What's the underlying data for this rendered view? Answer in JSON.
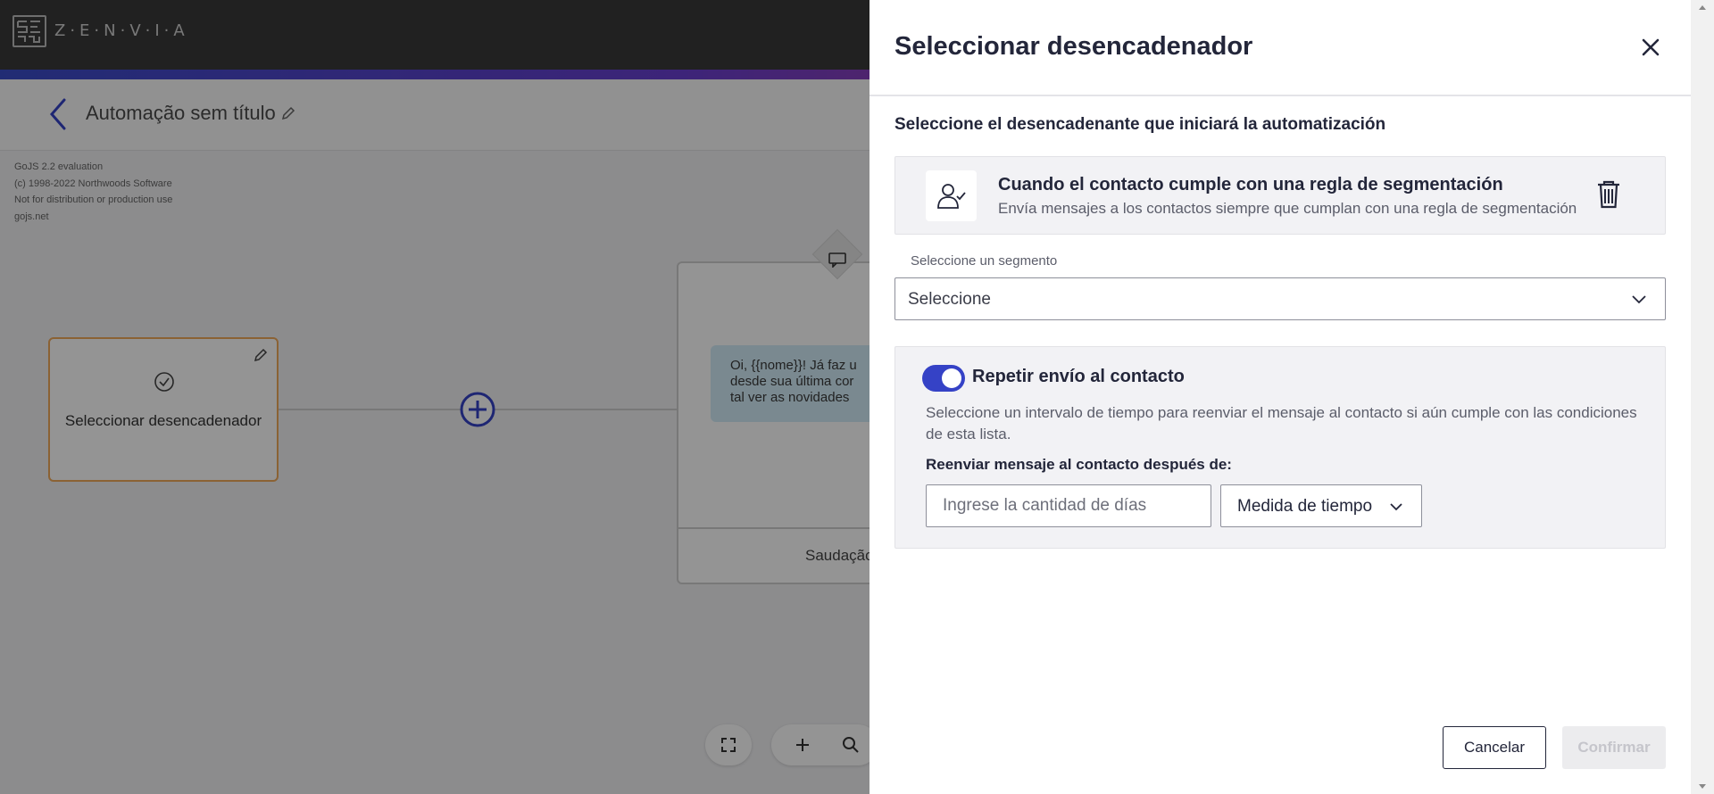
{
  "brand": {
    "name": "Z·E·N·V·I·A"
  },
  "automation": {
    "title": "Automação sem título"
  },
  "gojs_watermark": [
    "GoJS 2.2 evaluation",
    "(c) 1998-2022 Northwoods Software",
    "Not for distribution or production use",
    "gojs.net"
  ],
  "canvas": {
    "trigger_node_label": "Seleccionar desencadenador",
    "message_preview": [
      "Oi, {{nome}}! Já faz u",
      "desde sua última cor",
      "tal ver as novidades"
    ],
    "message_node_footer": "Saudação"
  },
  "drawer": {
    "title": "Seleccionar desencadenador",
    "subtitle": "Seleccione el desencadenante que iniciará la automatización",
    "trigger": {
      "title": "Cuando el contacto cumple con una regla de segmentación",
      "description": "Envía mensajes a los contactos siempre que cumplan con una regla de segmentación"
    },
    "segment": {
      "label": "Seleccione un segmento",
      "value": "Seleccione"
    },
    "repeat": {
      "enabled": true,
      "title": "Repetir envío al contacto",
      "description": "Seleccione un intervalo de tiempo para reenviar el mensaje al contacto si aún cumple con las condiciones de esta lista.",
      "resend_label": "Reenviar mensaje al contacto después de:",
      "days_placeholder": "Ingrese la cantidad de días",
      "days_value": "",
      "time_unit_value": "Medida de tiempo"
    },
    "buttons": {
      "cancel": "Cancelar",
      "confirm": "Confirmar"
    }
  },
  "colors": {
    "accent": "#3542c6",
    "trigger_border": "#f0a95a",
    "bubble": "#d2ecf8",
    "heading": "#23263a"
  }
}
